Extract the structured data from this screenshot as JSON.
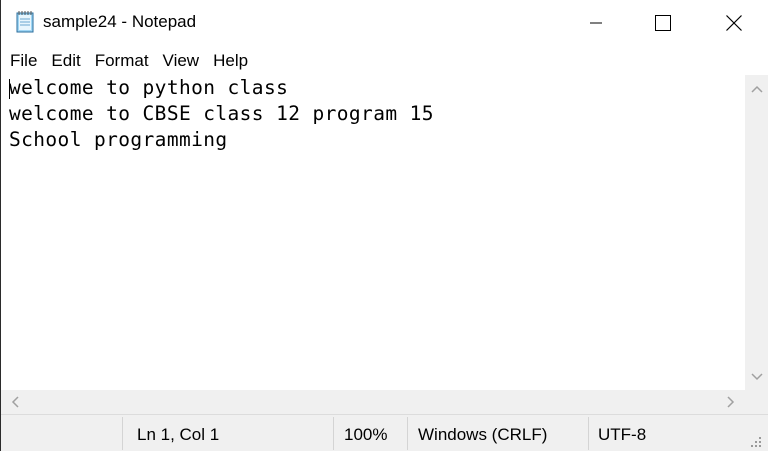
{
  "window": {
    "title": "sample24 - Notepad",
    "app_icon": "notepad-icon",
    "controls": {
      "minimize_icon": "minimize-icon",
      "maximize_icon": "maximize-icon",
      "close_icon": "close-icon"
    }
  },
  "menu": {
    "items": [
      {
        "label": "File"
      },
      {
        "label": "Edit"
      },
      {
        "label": "Format"
      },
      {
        "label": "View"
      },
      {
        "label": "Help"
      }
    ]
  },
  "editor": {
    "lines": [
      "welcome to python class",
      "welcome to CBSE class 12 program 15",
      "School programming"
    ]
  },
  "statusbar": {
    "position": "Ln 1, Col 1",
    "zoom": "100%",
    "line_ending": "Windows (CRLF)",
    "encoding": "UTF-8"
  },
  "colors": {
    "background": "#ffffff",
    "chrome": "#f0f0f0",
    "text": "#000000",
    "arrow": "#a0a0a0"
  }
}
